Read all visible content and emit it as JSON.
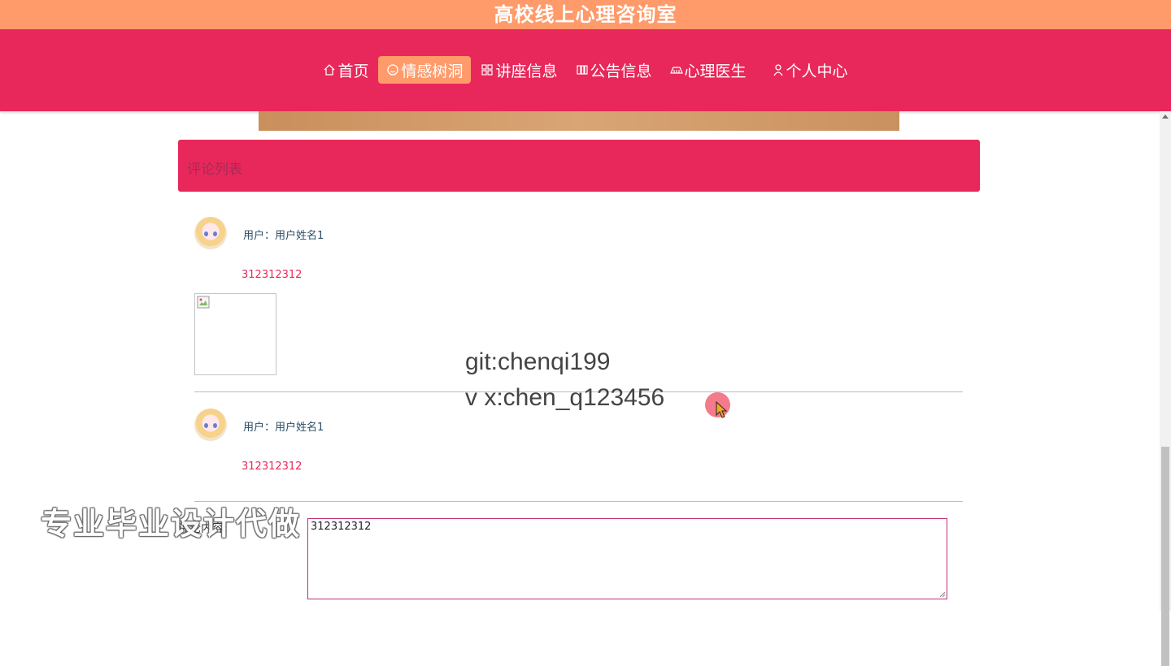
{
  "site_title": "高校线上心理咨询室",
  "nav": {
    "items": [
      {
        "label": "首页",
        "icon": "home-icon",
        "active": false
      },
      {
        "label": "情感树洞",
        "icon": "smile-icon",
        "active": true
      },
      {
        "label": "讲座信息",
        "icon": "grid-icon",
        "active": false
      },
      {
        "label": "公告信息",
        "icon": "notice-icon",
        "active": false
      },
      {
        "label": "心理医生",
        "icon": "doctor-icon",
        "active": false
      },
      {
        "label": "个人中心",
        "icon": "user-icon",
        "active": false
      }
    ]
  },
  "comments_section": {
    "title": "评论列表",
    "comments": [
      {
        "user": "用户：用户姓名1",
        "content": "312312312",
        "has_image": true
      },
      {
        "user": "用户：用户姓名1",
        "content": "312312312",
        "has_image": false
      }
    ]
  },
  "comment_form": {
    "label": "评论内容:",
    "value": "312312312"
  },
  "overlays": {
    "git": "git:chenqi199",
    "wechat": "v x:chen_q123456",
    "promo": "专业毕业设计代做"
  },
  "colors": {
    "primary": "#e8285a",
    "accent": "#ff9a6a"
  }
}
